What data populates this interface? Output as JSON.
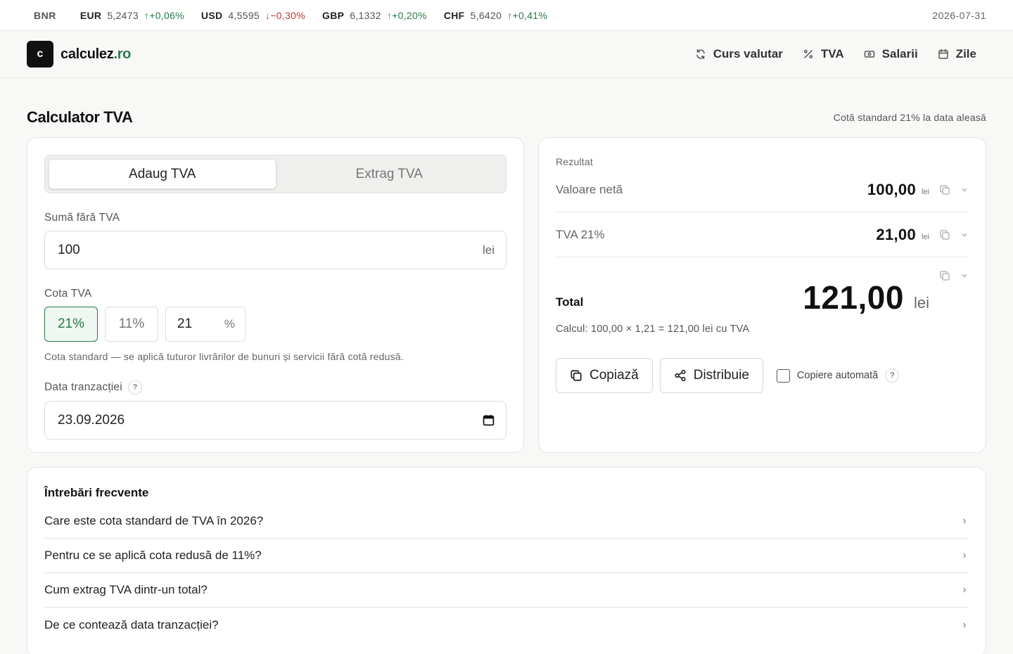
{
  "ticker": {
    "source": "BNR",
    "rates": [
      {
        "code": "EUR",
        "value": "5,2473",
        "change": "↑+0,06%",
        "direction": "up"
      },
      {
        "code": "USD",
        "value": "4,5595",
        "change": "↓−0,30%",
        "direction": "down"
      },
      {
        "code": "GBP",
        "value": "6,1332",
        "change": "↑+0,20%",
        "direction": "up"
      },
      {
        "code": "CHF",
        "value": "5,6420",
        "change": "↑+0,41%",
        "direction": "up"
      }
    ],
    "date": "2026-07-31"
  },
  "header": {
    "logo_letter": "c",
    "logo_name": "calculez",
    "logo_tld": ".ro",
    "nav": [
      {
        "label": "Curs valutar",
        "icon": "refresh-icon"
      },
      {
        "label": "TVA",
        "icon": "percent-icon"
      },
      {
        "label": "Salarii",
        "icon": "banknote-icon"
      },
      {
        "label": "Zile",
        "icon": "calendar-icon"
      }
    ]
  },
  "page": {
    "title": "Calculator TVA",
    "note": "Cotă standard 21% la data aleasă"
  },
  "form": {
    "mode_tabs": [
      "Adaug TVA",
      "Extrag TVA"
    ],
    "active_tab": "Adaug TVA",
    "amount_label": "Sumă fără TVA",
    "amount_value": "100",
    "amount_unit": "lei",
    "rate_label": "Cota TVA",
    "rate_options": [
      "21%",
      "11%"
    ],
    "rate_selected": "21%",
    "rate_custom_value": "21",
    "rate_custom_unit": "%",
    "rate_hint": "Cota standard — se aplică tuturor livrărilor de bunuri și servicii fără cotă redusă.",
    "date_label": "Data tranzacției",
    "help_glyph": "?",
    "date_value": "23.09.2026"
  },
  "result": {
    "title": "Rezultat",
    "net_label": "Valoare netă",
    "net_value": "100,00",
    "vat_label": "TVA 21%",
    "vat_value": "21,00",
    "unit": "lei",
    "total_label": "Total",
    "total_value": "121,00",
    "calc_line": "Calcul: 100,00 × 1,21 = 121,00 lei cu TVA",
    "copy_button": "Copiază",
    "share_button": "Distribuie",
    "auto_copy_label": "Copiere automată"
  },
  "faq": {
    "title": "Întrebări frecvente",
    "items": [
      "Care este cota standard de TVA în 2026?",
      "Pentru ce se aplică cota redusă de 11%?",
      "Cum extrag TVA dintr-un total?",
      "De ce contează data tranzacției?"
    ]
  },
  "colors": {
    "accent": "#2b7a4b",
    "down": "#c2392b",
    "logo_bg": "#111111"
  }
}
